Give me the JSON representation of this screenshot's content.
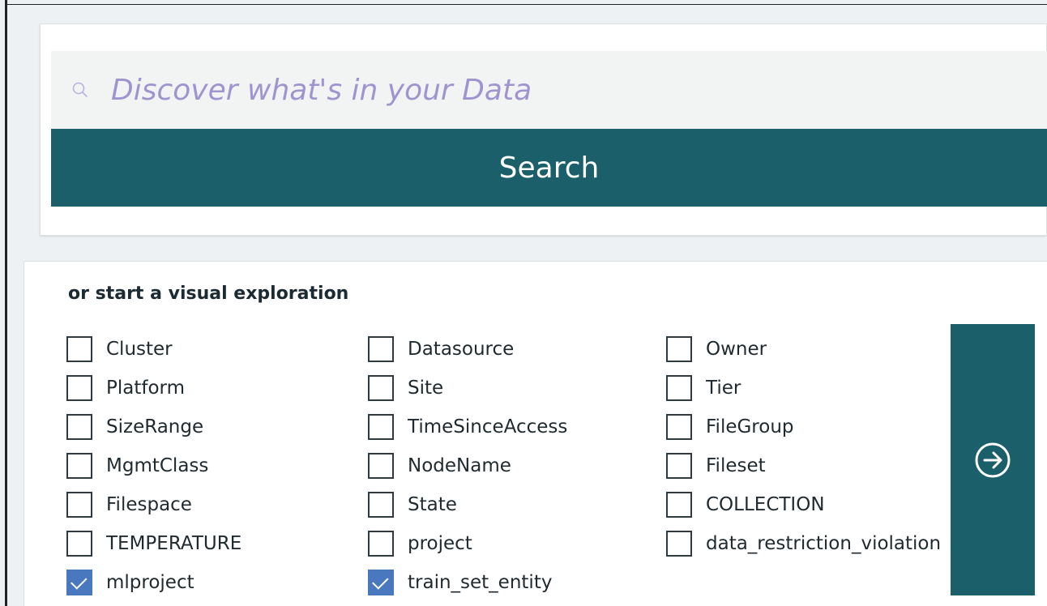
{
  "search": {
    "placeholder": "Discover what's in your Data",
    "button_label": "Search"
  },
  "exploration": {
    "heading": "or start a visual exploration",
    "columns": [
      [
        {
          "label": "Cluster",
          "checked": false
        },
        {
          "label": "Platform",
          "checked": false
        },
        {
          "label": "SizeRange",
          "checked": false
        },
        {
          "label": "MgmtClass",
          "checked": false
        },
        {
          "label": "Filespace",
          "checked": false
        },
        {
          "label": "TEMPERATURE",
          "checked": false
        },
        {
          "label": "mlproject",
          "checked": true
        }
      ],
      [
        {
          "label": "Datasource",
          "checked": false
        },
        {
          "label": "Site",
          "checked": false
        },
        {
          "label": "TimeSinceAccess",
          "checked": false
        },
        {
          "label": "NodeName",
          "checked": false
        },
        {
          "label": "State",
          "checked": false
        },
        {
          "label": "project",
          "checked": false
        },
        {
          "label": "train_set_entity",
          "checked": true
        }
      ],
      [
        {
          "label": "Owner",
          "checked": false
        },
        {
          "label": "Tier",
          "checked": false
        },
        {
          "label": "FileGroup",
          "checked": false
        },
        {
          "label": "Fileset",
          "checked": false
        },
        {
          "label": "COLLECTION",
          "checked": false
        },
        {
          "label": "data_restriction_violation",
          "checked": false
        }
      ]
    ],
    "go_icon": "arrow-right-circle-icon"
  },
  "colors": {
    "accent": "#1a5f6a",
    "checkbox_checked": "#4a78bf",
    "placeholder": "#9f94cf"
  }
}
